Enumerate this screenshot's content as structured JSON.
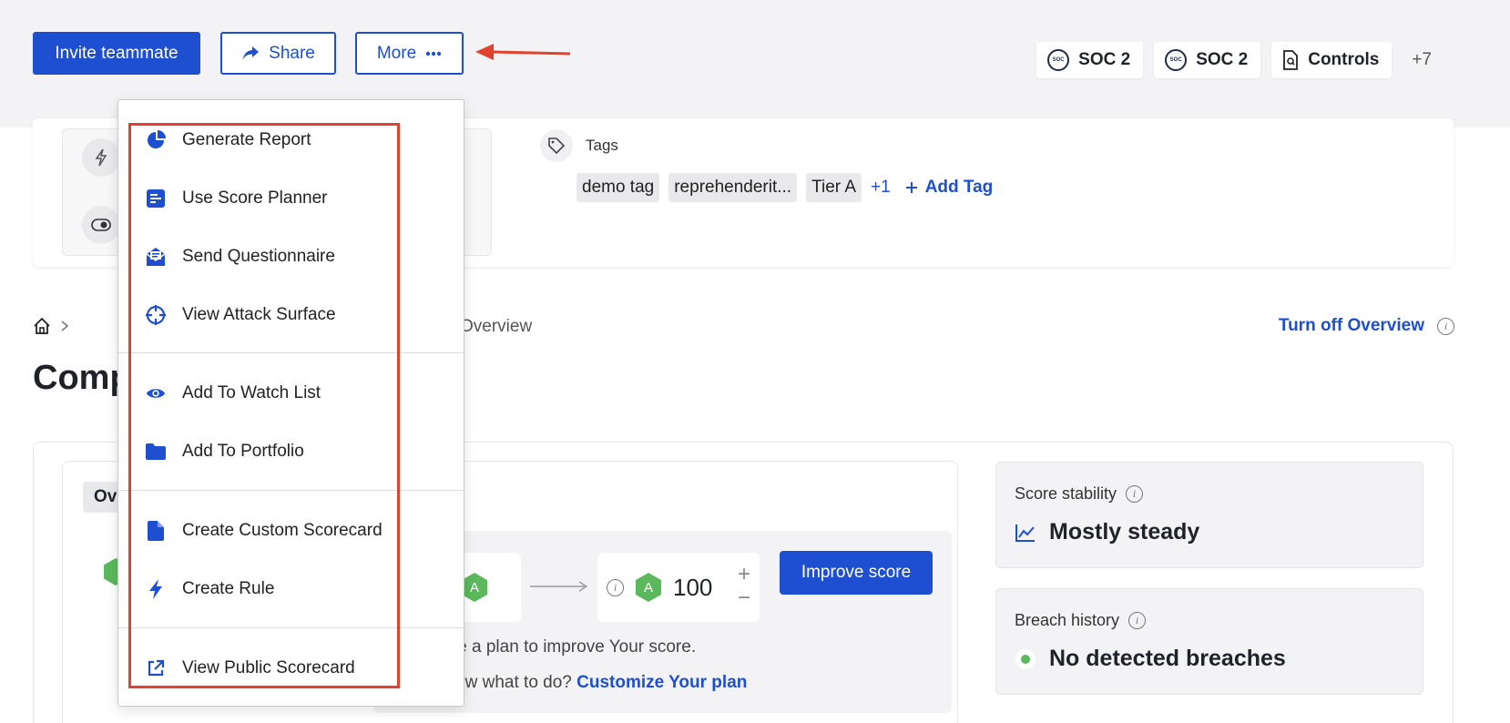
{
  "header": {
    "invite_label": "Invite teammate",
    "share_label": "Share",
    "more_label": "More"
  },
  "badges": [
    {
      "label": "SOC 2",
      "icon": "aicpa-soc2-icon"
    },
    {
      "label": "SOC 2",
      "icon": "aicpa-soc2-icon"
    },
    {
      "label": "Controls",
      "icon": "document-search-icon"
    }
  ],
  "badges_more": "+7",
  "tags": {
    "label": "Tags",
    "items": [
      "demo tag",
      "reprehenderit...",
      "Tier A"
    ],
    "more": "+1",
    "add_label": "Add Tag"
  },
  "breadcrumb": {
    "current": "Overview"
  },
  "turn_off_overview": "Turn off Overview",
  "page_title": "Comp",
  "overview_tab": "Ov",
  "planner": {
    "current_grade": "A",
    "target_grade": "A",
    "target_score": "100",
    "improve_label": "Improve score",
    "generate_text": "rate a plan to improve Your score.",
    "know_prefix": "know what to do?",
    "customize_link": "Customize Your plan"
  },
  "score_stability": {
    "label": "Score stability",
    "value": "Mostly steady"
  },
  "breach_history": {
    "label": "Breach history",
    "value": "No detected breaches"
  },
  "more_menu": {
    "items": [
      {
        "label": "Generate Report",
        "icon": "pie-chart-icon"
      },
      {
        "label": "Use Score Planner",
        "icon": "planner-icon"
      },
      {
        "label": "Send Questionnaire",
        "icon": "questionnaire-icon"
      },
      {
        "label": "View Attack Surface",
        "icon": "crosshair-icon"
      },
      {
        "label": "Add To Watch List",
        "icon": "eye-icon"
      },
      {
        "label": "Add To Portfolio",
        "icon": "folder-icon"
      },
      {
        "label": "Create Custom Scorecard",
        "icon": "file-icon"
      },
      {
        "label": "Create Rule",
        "icon": "lightning-icon"
      },
      {
        "label": "View Public Scorecard",
        "icon": "external-link-icon"
      }
    ]
  },
  "colors": {
    "primary": "#1e4fd0",
    "highlight": "#e2412e",
    "grade_green": "#5cb85c"
  }
}
